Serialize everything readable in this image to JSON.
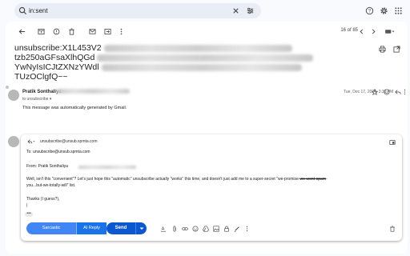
{
  "search": {
    "query": "in:sent",
    "icons": [
      "search-icon",
      "clear-icon",
      "filter-options-icon"
    ]
  },
  "top_right_icons": [
    "help-icon",
    "settings-icon",
    "apps-icon"
  ],
  "toolbar": {
    "icons": [
      "back-arrow-icon",
      "archive-icon",
      "report-spam-icon",
      "delete-icon",
      "mark-unread-icon",
      "move-to-icon",
      "more-options-icon"
    ],
    "pager": "16 of 85",
    "nav_icons": [
      "chevron-left-icon",
      "chevron-right-icon",
      "keyboard-icon"
    ]
  },
  "email": {
    "subject_lines": [
      "unsubscribe:X1L453V2",
      "tzb250aGFsaXlhQGd",
      "YwNyIsICJtZXNzYWdl",
      "TUzOClgfQ~~"
    ],
    "subject_icons": [
      "print-icon",
      "open-new-window-icon"
    ],
    "message": {
      "sender": "Pratik Sonthaliya",
      "recipient": "to unsubscribe",
      "date": "Tue, Dec 17, 2024, 3:30 PM",
      "body": "This message was automatically generated by Gmail.",
      "icons": [
        "star-icon",
        "emoji-icon",
        "reply-icon",
        "more-vert-icon"
      ]
    }
  },
  "reply": {
    "to_header": "unsubscribe@unsub.spmta.com",
    "to_line": "To: unsubscribe@unsub.spmta.com",
    "from_line": "From: Pratik Sonthaliya",
    "message_part1": "Well, isn't this \"convenient\"? Let's just hope this \"automatic\" unsubscribe actually \"works\" this time, and doesn't just add me to a super-secret \"we-promise-",
    "message_strike": "we-wont-spam",
    "message_part2": "-",
    "message_line2": "you...but-we-totally-will\" list.",
    "thanks": "Thanks (I guess?),",
    "cursor": "|",
    "dots": "•••",
    "buttons": {
      "sarcastic": "Sarcastic",
      "ai_reply": "AI Reply",
      "send": "Send"
    },
    "format_icons": [
      "text-format-icon",
      "attach-icon",
      "link-icon",
      "emoji-icon",
      "drive-icon",
      "photo-icon",
      "lock-icon",
      "pen-icon",
      "more-vert-icon",
      "trash-icon"
    ],
    "header_icons": [
      "reply-type-icon",
      "popout-icon"
    ]
  }
}
